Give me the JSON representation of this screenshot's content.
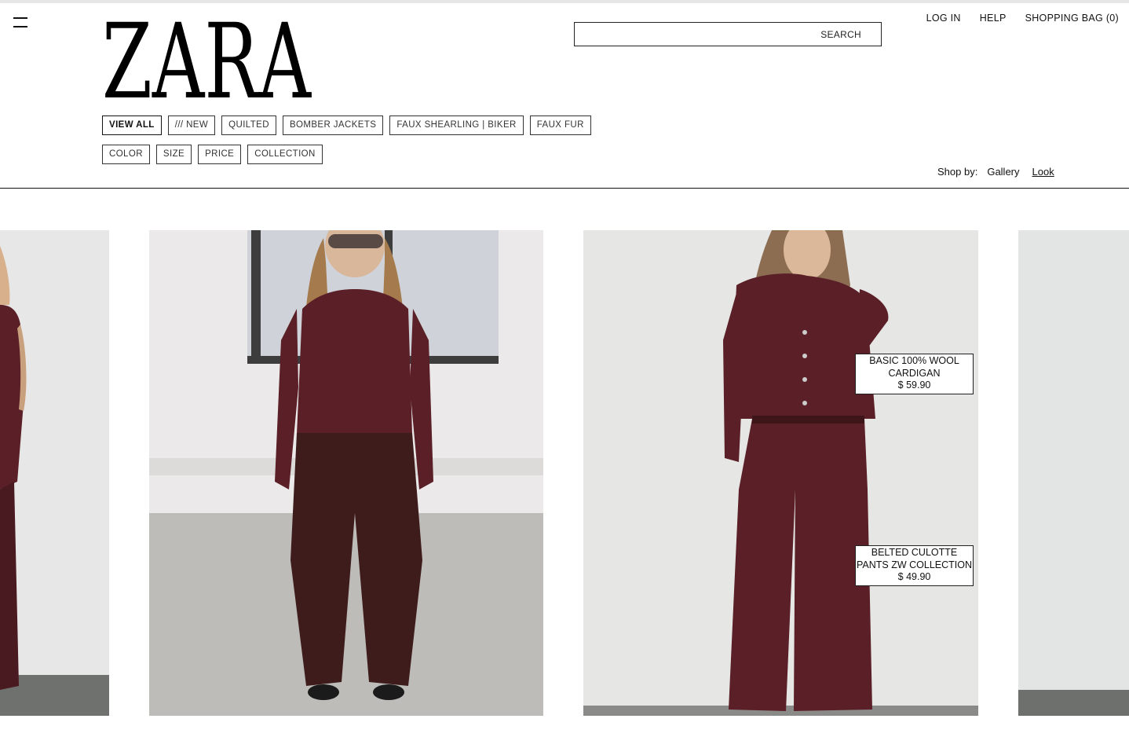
{
  "brand": {
    "logo_text": "ZARA"
  },
  "header": {
    "search_label": "SEARCH",
    "links": {
      "login": "LOG IN",
      "help": "HELP",
      "bag": "SHOPPING BAG (0)"
    }
  },
  "filters": {
    "categories": [
      "VIEW ALL",
      "/// NEW",
      "QUILTED",
      "BOMBER JACKETS",
      "FAUX SHEARLING | BIKER",
      "FAUX FUR"
    ],
    "refine": [
      "COLOR",
      "SIZE",
      "PRICE",
      "COLLECTION"
    ]
  },
  "shop_by": {
    "label": "Shop by:",
    "gallery": "Gallery",
    "look": "Look"
  },
  "products": [
    {
      "name_line1": "BASIC 100% WOOL",
      "name_line2": "CARDIGAN",
      "price": "$ 59.90"
    },
    {
      "name_line1": "BELTED CULOTTE",
      "name_line2": "PANTS ZW COLLECTION",
      "price": "$ 49.90"
    }
  ],
  "colors": {
    "garment": "#5a1f27",
    "backdrop": "#e8e8e6"
  }
}
